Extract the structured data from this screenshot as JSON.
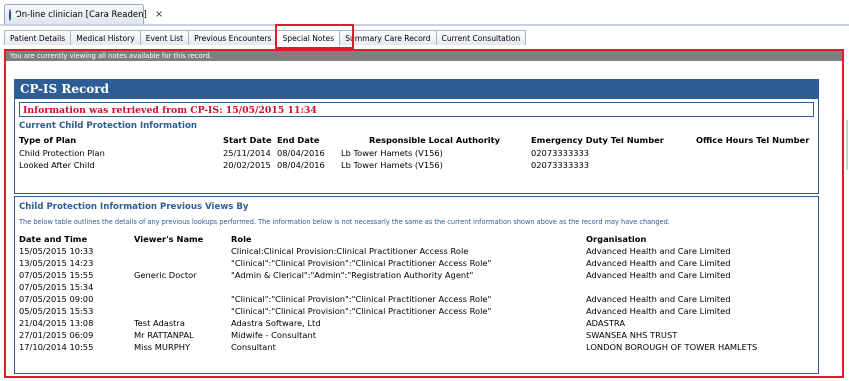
{
  "window_tab": {
    "title": "On-line clinician [Cara Readen]",
    "close": "×"
  },
  "tabs": [
    {
      "label": "Patient Details"
    },
    {
      "label": "Medical History"
    },
    {
      "label": "Event List"
    },
    {
      "label": "Previous Encounters"
    },
    {
      "label": "Special Notes"
    },
    {
      "label": "Summary Care Record"
    },
    {
      "label": "Current Consultation"
    }
  ],
  "notice": "You are currently viewing all notes available for this record.",
  "record": {
    "title": "CP-IS Record",
    "retrieved": "Information was retrieved from CP-IS: 15/05/2015 11:34",
    "section_title": "Current Child Protection Information",
    "headers": {
      "type": "Type of Plan",
      "start": "Start Date",
      "end": "End Date",
      "authority": "Responsible Local Authority",
      "emergency": "Emergency Duty Tel Number",
      "office": "Office Hours Tel Number"
    },
    "rows": [
      {
        "type": "Child Protection Plan",
        "start": "25/11/2014",
        "end": "08/04/2016",
        "authority": "Lb Tower Hamets (V156)",
        "emergency": "02073333333",
        "office": ""
      },
      {
        "type": "Looked After Child",
        "start": "20/02/2015",
        "end": "08/04/2016",
        "authority": "Lb Tower Hamets (V156)",
        "emergency": "02073333333",
        "office": ""
      }
    ]
  },
  "views": {
    "title": "Child Protection Information Previous Views By",
    "subtext": "The below table outlines the details of any previous lookups performed. The information below is not necessarly the same as the current information shown above as the record may have changed.",
    "headers": {
      "date": "Date and Time",
      "viewer": "Viewer's Name",
      "role": "Role",
      "org": "Organisation"
    },
    "rows": [
      {
        "date": "15/05/2015 10:33",
        "viewer": "",
        "role": "Clinical:Clinical Provision:Clinical Practitioner Access Role",
        "org": "Advanced Health and Care Limited"
      },
      {
        "date": "13/05/2015 14:23",
        "viewer": "",
        "role": "\"Clinical\":\"Clinical Provision\":\"Clinical Practitioner Access Role\"",
        "org": "Advanced Health and Care Limited"
      },
      {
        "date": "07/05/2015 15:55",
        "viewer": "Generic Doctor",
        "role": "\"Admin & Clerical\":\"Admin\":\"Registration Authority Agent\"",
        "org": "Advanced Health and Care Limited"
      },
      {
        "date": "07/05/2015 15:34",
        "viewer": "",
        "role": "",
        "org": ""
      },
      {
        "date": "07/05/2015 09:00",
        "viewer": "",
        "role": "\"Clinical\":\"Clinical Provision\":\"Clinical Practitioner Access Role\"",
        "org": "Advanced Health and Care Limited"
      },
      {
        "date": "05/05/2015 15:53",
        "viewer": "",
        "role": "\"Clinical\":\"Clinical Provision\":\"Clinical Practitioner Access Role\"",
        "org": "Advanced Health and Care Limited"
      },
      {
        "date": "21/04/2015 13:08",
        "viewer": "Test Adastra",
        "role": "Adastra Software, Ltd",
        "org": "ADASTRA"
      },
      {
        "date": "27/01/2015 06:09",
        "viewer": "Mr RATTANPAL",
        "role": "Midwife - Consultant",
        "org": "SWANSEA NHS TRUST"
      },
      {
        "date": "17/10/2014 10:55",
        "viewer": "Miss MURPHY",
        "role": "Consultant",
        "org": "LONDON BOROUGH OF TOWER HAMLETS"
      }
    ]
  },
  "colors": {
    "header_blue": "#2e5d95",
    "highlight_red": "#e0192b",
    "retrieved_red": "#c8102e"
  }
}
